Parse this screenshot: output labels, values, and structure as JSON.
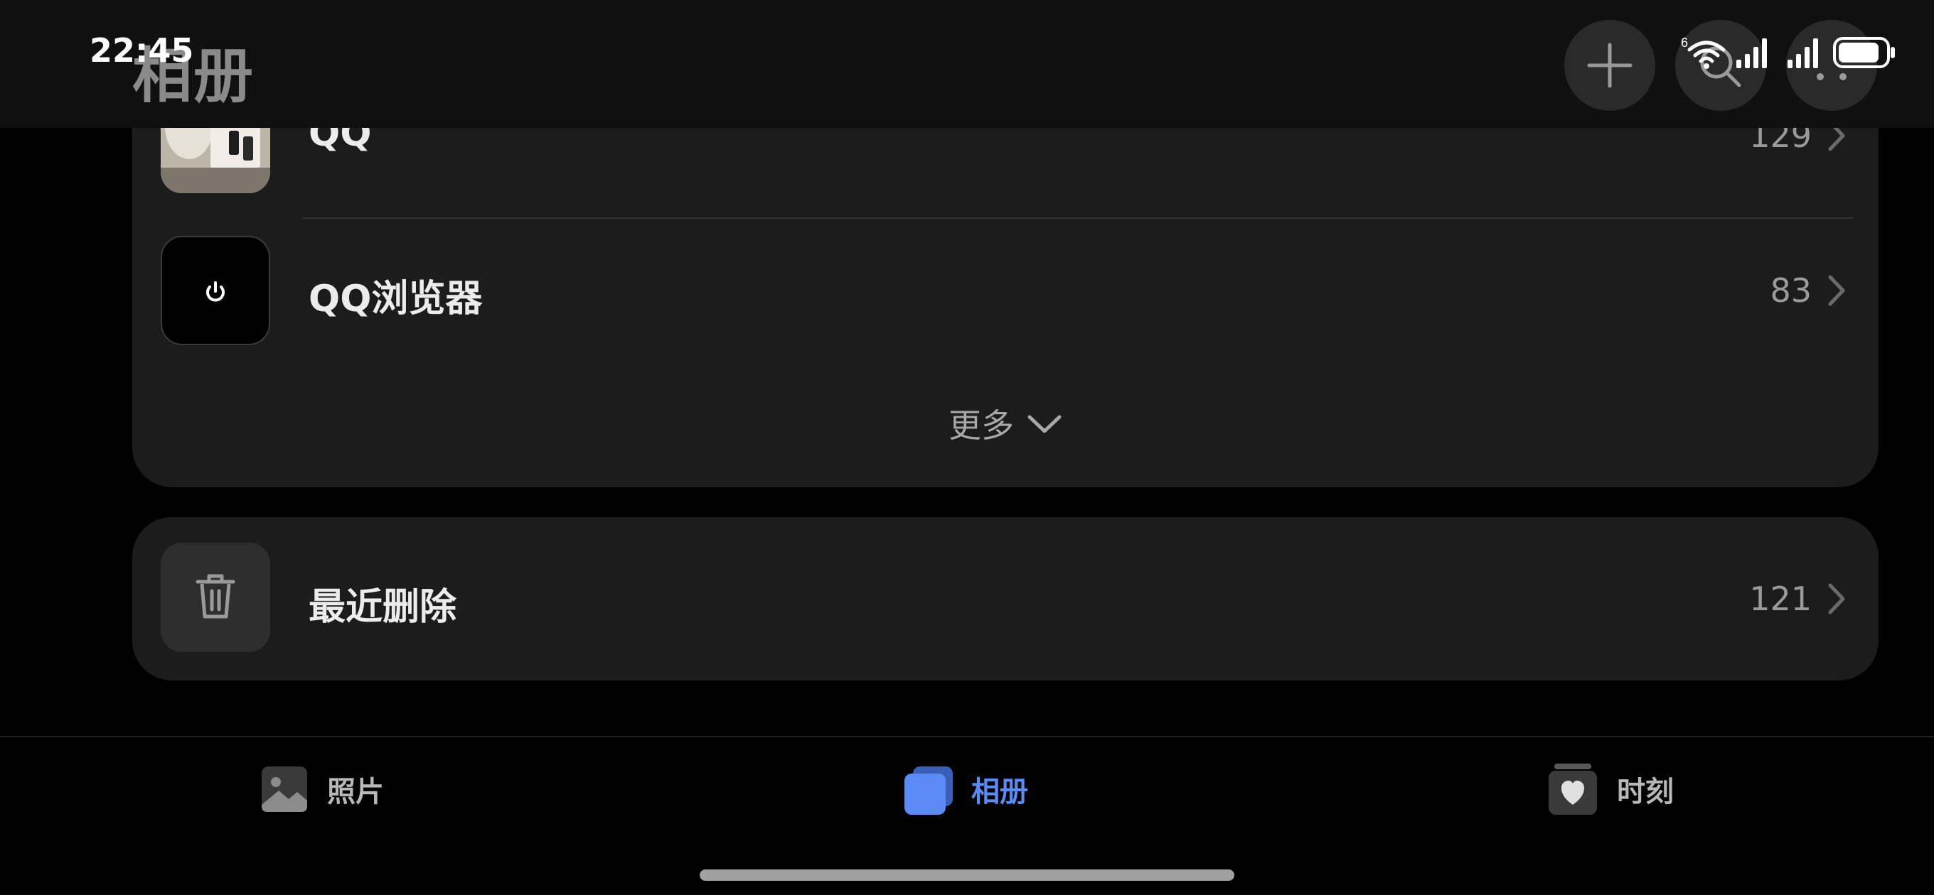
{
  "status_bar": {
    "time": "22:45",
    "wifi_badge": "6",
    "icons": [
      "wifi-icon",
      "signal-icon",
      "signal-icon",
      "battery-icon"
    ]
  },
  "header": {
    "title": "相册",
    "actions": [
      "plus-icon",
      "search-icon",
      "more-icon"
    ]
  },
  "albums": {
    "items": [
      {
        "name": "QQ",
        "count": "129",
        "thumb": "photo-thumbnail"
      },
      {
        "name": "QQ浏览器",
        "count": "83",
        "thumb": "power-icon"
      }
    ],
    "more_label": "更多"
  },
  "recently_deleted": {
    "name": "最近删除",
    "count": "121",
    "icon": "trash-icon"
  },
  "tabs": [
    {
      "label": "照片",
      "icon": "photo-icon",
      "active": false
    },
    {
      "label": "相册",
      "icon": "album-icon",
      "active": true
    },
    {
      "label": "时刻",
      "icon": "moments-icon",
      "active": false
    }
  ],
  "colors": {
    "accent": "#5b8cf5",
    "background": "#000000",
    "card": "#1c1c1c"
  }
}
